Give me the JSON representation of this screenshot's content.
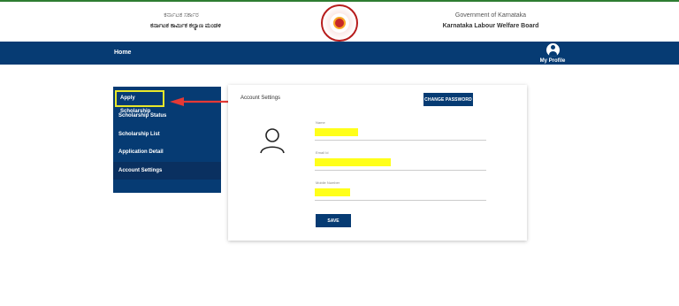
{
  "header": {
    "kannada_title": "ಕರ್ನಾಟಕ ಸರ್ಕಾರ",
    "kannada_subtitle": "ಕರ್ನಾಟಕ ಕಾರ್ಮಿಕ ಕಲ್ಯಾಣ ಮಂಡಳಿ",
    "gov_title": "Government of Karnataka",
    "board_name": "Karnataka Labour Welfare Board"
  },
  "nav": {
    "home": "Home",
    "profile": "My Profile"
  },
  "sidebar": {
    "items": [
      {
        "label": "Apply Scholarship"
      },
      {
        "label": "Scholarship Status"
      },
      {
        "label": "Scholarship List"
      },
      {
        "label": "Application Detail"
      },
      {
        "label": "Account Settings"
      }
    ]
  },
  "settings": {
    "title": "Account Settings",
    "change_password": "CHANGE PASSWORD",
    "name_label": "Name",
    "email_label": "Email Id",
    "mobile_label": "Mobile Number",
    "save": "SAVE"
  },
  "colors": {
    "primary": "#063b73",
    "highlight": "#ffff1a",
    "annotation": "#e53935"
  }
}
